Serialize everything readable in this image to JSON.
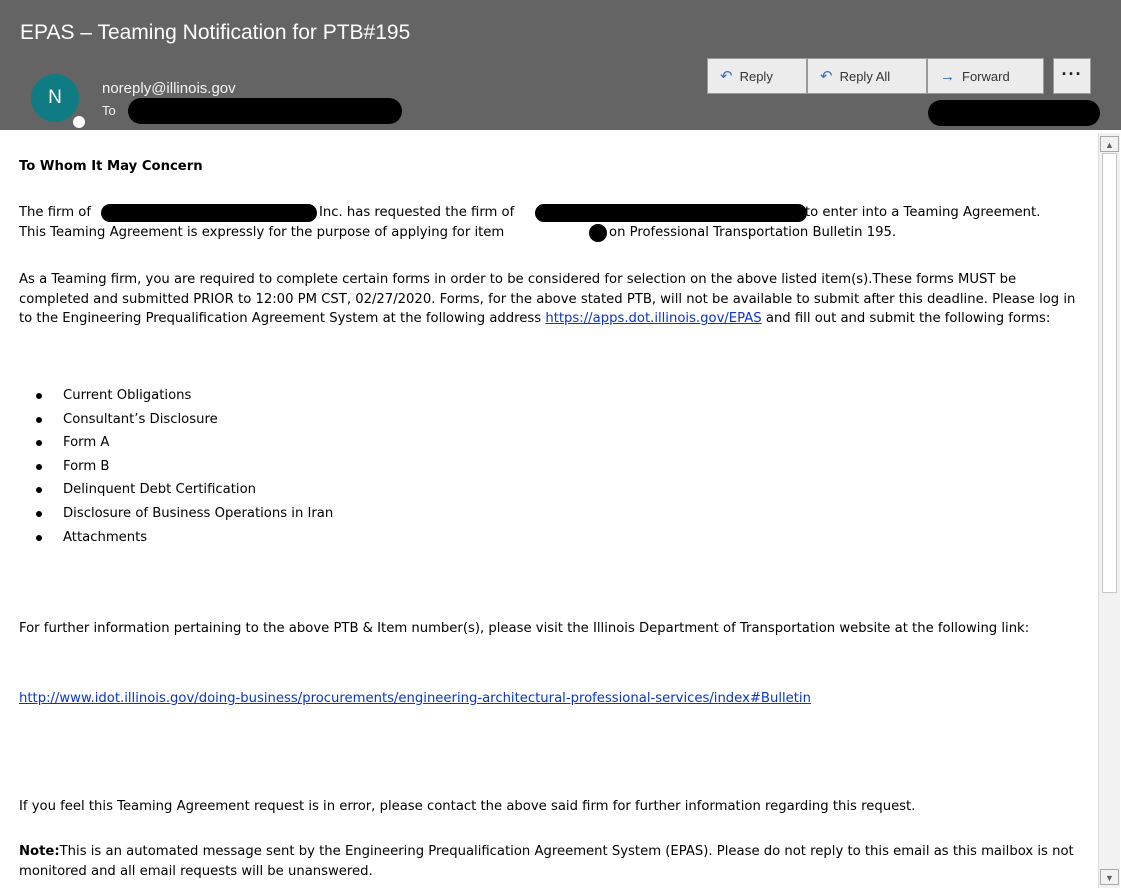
{
  "header": {
    "subject": "EPAS – Teaming Notification for PTB#195",
    "avatar_initial": "N",
    "sender": "noreply@illinois.gov",
    "to_label": "To"
  },
  "actions": {
    "reply": "Reply",
    "reply_all": "Reply All",
    "forward": "Forward",
    "more": "···"
  },
  "message": {
    "greeting": "To Whom It May Concern",
    "p1_a": "The firm of",
    "p1_b": "Inc. has requested the firm of",
    "p1_c": "to enter into a Teaming Agreement.",
    "p1_d": "This Teaming Agreement is expressly for the purpose of applying for item",
    "p1_e": "on Professional Transportation Bulletin 195.",
    "p2": "As a Teaming firm, you are required to complete certain forms in order to be considered for selection on the above listed item(s).These forms MUST be completed and submitted PRIOR to 12:00 PM CST, 02/27/2020. Forms, for the above stated PTB, will not be available to submit after this deadline. Please log in to the Engineering Prequalification Agreement System at the following address",
    "p2_link": "https://apps.dot.illinois.gov/EPAS",
    "p2_end": "and fill out and submit the following forms:",
    "forms": [
      "Current Obligations",
      "Consultant’s Disclosure",
      "Form A",
      "Form B",
      "Delinquent Debt Certification",
      "Disclosure of Business Operations in Iran",
      "Attachments"
    ],
    "p3": "For further information pertaining to the above PTB & Item number(s), please visit the Illinois Department of Transportation website at the following link:",
    "p3_link": "http://www.idot.illinois.gov/doing-business/procurements/engineering-architectural-professional-services/index#Bulletin",
    "p4": "If you feel this Teaming Agreement request is in error, please contact the above said firm for further information regarding this request.",
    "note_label": "Note:",
    "note_text": "This is an automated message sent by the Engineering Prequalification Agreement System (EPAS). Please do not reply to this email as this mailbox is not monitored and all email requests will be unanswered."
  },
  "colors": {
    "header_bg": "#646464",
    "avatar_bg": "#0f7c83",
    "link": "#0b36c4"
  }
}
